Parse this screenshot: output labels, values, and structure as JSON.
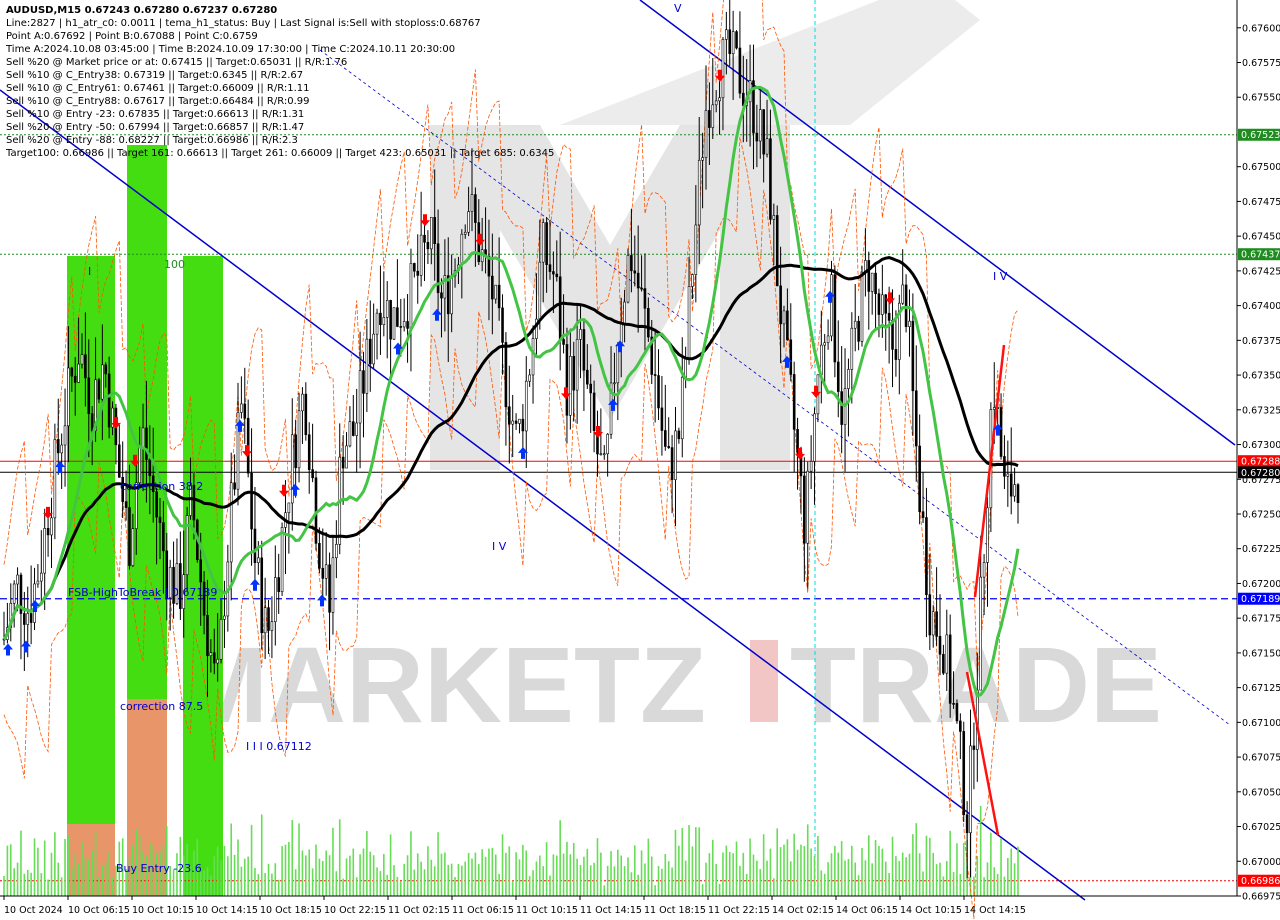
{
  "info_lines": [
    "AUDUSD,M15  0.67243 0.67280 0.67237 0.67280",
    "Line:2827 | h1_atr_c0: 0.0011 | tema_h1_status: Buy | Last Signal is:Sell with stoploss:0.68767",
    "Point A:0.67692 | Point B:0.67088 | Point C:0.6759",
    "Time A:2024.10.08 03:45:00 | Time B:2024.10.09 17:30:00 | Time C:2024.10.11 20:30:00",
    "Sell %20 @ Market price or at: 0.67415 || Target:0.65031 || R/R:1.76",
    "Sell %10 @ C_Entry38: 0.67319 || Target:0.6345 || R/R:2.67",
    "Sell %10 @ C_Entry61: 0.67461 || Target:0.66009 || R/R:1.11",
    "Sell %10 @ C_Entry88: 0.67617 || Target:0.66484 || R/R:0.99",
    "Sell %10 @ Entry -23: 0.67835 || Target:0.66613 || R/R:1.31",
    "Sell %20 @ Entry -50: 0.67994 || Target:0.66857 || R/R:1.47",
    "Sell %20 @ Entry -88: 0.68227 || Target:0.66986 || R/R:2.3",
    "Target100: 0.66986 || Target 161: 0.66613 || Target 261: 0.66009 || Target 423: 0.65031 || Target 685: 0.6345"
  ],
  "watermark": {
    "part1": "MARKETZ",
    "part2": "TRADE"
  },
  "colors": {
    "background": "#ffffff",
    "bull_candle": "#000000",
    "bear_candle": "#000000",
    "ma_black": "#000000",
    "ma_green": "#44c444",
    "channel": "#0000cc",
    "dashed_orange": "#ff5500",
    "level_green": "#1e8c1e",
    "level_red": "#ff0000",
    "level_blue": "#0000ff",
    "volume": "#66dd55",
    "arrow_up": "#0033ff",
    "arrow_down": "#ff0000",
    "zone_green": "#44dd11",
    "zone_orange": "#e8956a",
    "wedge_red": "#ff1111",
    "cursor_cyan": "#00dddd"
  },
  "annotations": {
    "correction_382": "correction 38.2",
    "correction_875": "correction 87.5",
    "buy_entry": "Buy Entry -23.6",
    "fsb": "FSB-HighToBreak | 0.67189",
    "wave_iii": "I I I 0.67112",
    "wave_iv": "I V",
    "wave_v": "V",
    "wave_iv_small": "I V",
    "label_100": "100",
    "label_i": "I"
  },
  "chart_data": {
    "type": "candlestick",
    "symbol": "AUDUSD",
    "timeframe": "M15",
    "ohlc_last": {
      "open": 0.67243,
      "high": 0.6728,
      "low": 0.67237,
      "close": 0.6728
    },
    "ylim": [
      0.66975,
      0.6762
    ],
    "y_ticks": [
      "0.67600",
      "0.67575",
      "0.67550",
      "0.67500",
      "0.67475",
      "0.67450",
      "0.67425",
      "0.67400",
      "0.67375",
      "0.67350",
      "0.67325",
      "0.67300",
      "0.67275",
      "0.67250",
      "0.67225",
      "0.67200",
      "0.67175",
      "0.67150",
      "0.67125",
      "0.67100",
      "0.67075",
      "0.67050",
      "0.67025",
      "0.67000",
      "0.66975"
    ],
    "x_ticks": [
      "10 Oct 2024",
      "10 Oct 06:15",
      "10 Oct 10:15",
      "10 Oct 14:15",
      "10 Oct 18:15",
      "10 Oct 22:15",
      "11 Oct 02:15",
      "11 Oct 06:15",
      "11 Oct 10:15",
      "11 Oct 14:15",
      "11 Oct 18:15",
      "11 Oct 22:15",
      "14 Oct 02:15",
      "14 Oct 06:15",
      "14 Oct 10:15",
      "14 Oct 14:15"
    ],
    "levels": [
      {
        "value": 0.67523,
        "label": "0.67523",
        "color": "#1e8c1e",
        "style": "dotted"
      },
      {
        "value": 0.67437,
        "label": "0.67437",
        "color": "#1e8c1e",
        "style": "dotted"
      },
      {
        "value": 0.67288,
        "label": "0.67288",
        "color": "#ff0000",
        "style": "solid"
      },
      {
        "value": 0.6728,
        "label": "0.67280",
        "color": "#000000",
        "style": "solid"
      },
      {
        "value": 0.67189,
        "label": "0.67189",
        "color": "#0000ff",
        "style": "dashed"
      },
      {
        "value": 0.66986,
        "label": "0.66986",
        "color": "#ff0000",
        "style": "dotted"
      }
    ],
    "close_path": [
      0.6716,
      0.672,
      0.6718,
      0.6722,
      0.6728,
      0.6733,
      0.6737,
      0.6733,
      0.6736,
      0.6729,
      0.6723,
      0.6731,
      0.6726,
      0.6721,
      0.6719,
      0.6726,
      0.6718,
      0.6712,
      0.6724,
      0.6733,
      0.6722,
      0.6716,
      0.6722,
      0.6729,
      0.6734,
      0.6724,
      0.6718,
      0.673,
      0.6731,
      0.6736,
      0.6741,
      0.6739,
      0.674,
      0.6742,
      0.6745,
      0.674,
      0.6743,
      0.6748,
      0.6744,
      0.6741,
      0.6735,
      0.673,
      0.6736,
      0.6744,
      0.6742,
      0.6734,
      0.6737,
      0.6731,
      0.6727,
      0.6738,
      0.6744,
      0.674,
      0.6735,
      0.6728,
      0.6731,
      0.6743,
      0.6754,
      0.6757,
      0.6758,
      0.6756,
      0.6754,
      0.675,
      0.674,
      0.6732,
      0.6724,
      0.6735,
      0.6741,
      0.6732,
      0.6738,
      0.6743,
      0.6739,
      0.6737,
      0.6741,
      0.6728,
      0.6718,
      0.6716,
      0.671,
      0.6703,
      0.6718,
      0.6735,
      0.6726,
      0.6728
    ]
  }
}
